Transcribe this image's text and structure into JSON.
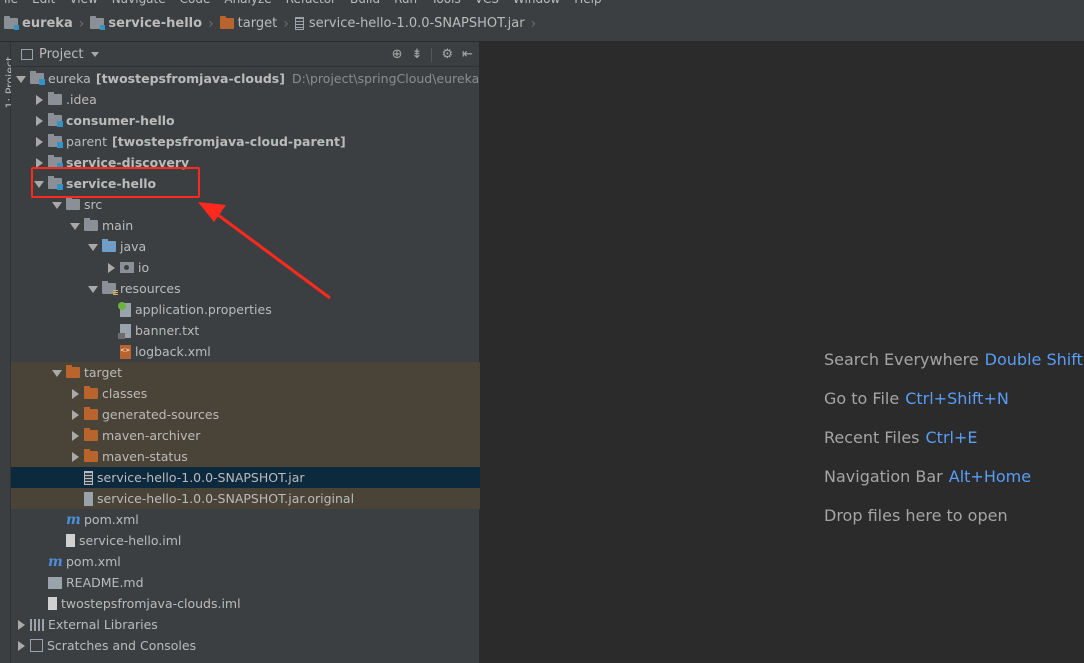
{
  "menu": [
    "ile",
    "Edit",
    "View",
    "Navigate",
    "Code",
    "Analyze",
    "Refactor",
    "Build",
    "Run",
    "Tools",
    "VCS",
    "Window",
    "Help"
  ],
  "breadcrumb": {
    "items": [
      {
        "label": "eureka",
        "bold": true
      },
      {
        "label": "service-hello",
        "bold": true
      },
      {
        "label": "target",
        "bold": false
      },
      {
        "label": "service-hello-1.0.0-SNAPSHOT.jar",
        "bold": false
      }
    ]
  },
  "side_stripe": {
    "tab_label": "1: Project"
  },
  "project_panel": {
    "title": "Project",
    "tree": [
      {
        "label": "eureka",
        "bracket": "[twostepsfromjava-clouds]",
        "path": "D:\\project\\springCloud\\eureka",
        "depth": 0,
        "arrow": "down",
        "icon": "module-folder",
        "bold": false
      },
      {
        "label": ".idea",
        "depth": 1,
        "arrow": "right",
        "icon": "folder",
        "bold": false
      },
      {
        "label": "consumer-hello",
        "depth": 1,
        "arrow": "right",
        "icon": "module-folder",
        "bold": true
      },
      {
        "label": "parent",
        "bracket": "[twostepsfromjava-cloud-parent]",
        "depth": 1,
        "arrow": "right",
        "icon": "module-folder",
        "bold": false
      },
      {
        "label": "service-discovery",
        "depth": 1,
        "arrow": "right",
        "icon": "module-folder",
        "bold": true
      },
      {
        "label": "service-hello",
        "depth": 1,
        "arrow": "down",
        "icon": "module-folder",
        "bold": true
      },
      {
        "label": "src",
        "depth": 2,
        "arrow": "down",
        "icon": "folder",
        "bold": false
      },
      {
        "label": "main",
        "depth": 3,
        "arrow": "down",
        "icon": "folder",
        "bold": false
      },
      {
        "label": "java",
        "depth": 4,
        "arrow": "down",
        "icon": "source-folder",
        "bold": false
      },
      {
        "label": "io",
        "depth": 5,
        "arrow": "right",
        "icon": "package",
        "bold": false
      },
      {
        "label": "resources",
        "depth": 4,
        "arrow": "down",
        "icon": "resource-folder",
        "bold": false
      },
      {
        "label": "application.properties",
        "depth": 5,
        "arrow": "none",
        "icon": "spring-file",
        "bold": false
      },
      {
        "label": "banner.txt",
        "depth": 5,
        "arrow": "none",
        "icon": "text-file",
        "bold": false
      },
      {
        "label": "logback.xml",
        "depth": 5,
        "arrow": "none",
        "icon": "xml-file",
        "bold": false
      },
      {
        "label": "target",
        "depth": 2,
        "arrow": "down",
        "icon": "excluded-folder",
        "bold": false,
        "state": "excluded"
      },
      {
        "label": "classes",
        "depth": 3,
        "arrow": "right",
        "icon": "excluded-folder",
        "bold": false,
        "state": "excluded"
      },
      {
        "label": "generated-sources",
        "depth": 3,
        "arrow": "right",
        "icon": "excluded-folder",
        "bold": false,
        "state": "excluded"
      },
      {
        "label": "maven-archiver",
        "depth": 3,
        "arrow": "right",
        "icon": "excluded-folder",
        "bold": false,
        "state": "excluded"
      },
      {
        "label": "maven-status",
        "depth": 3,
        "arrow": "right",
        "icon": "excluded-folder",
        "bold": false,
        "state": "excluded"
      },
      {
        "label": "service-hello-1.0.0-SNAPSHOT.jar",
        "depth": 3,
        "arrow": "none",
        "icon": "jar-file",
        "bold": false,
        "state": "selected"
      },
      {
        "label": "service-hello-1.0.0-SNAPSHOT.jar.original",
        "depth": 3,
        "arrow": "none",
        "icon": "original-file",
        "bold": false,
        "state": "excluded"
      },
      {
        "label": "pom.xml",
        "depth": 2,
        "arrow": "none",
        "icon": "maven-file",
        "bold": false
      },
      {
        "label": "service-hello.iml",
        "depth": 2,
        "arrow": "none",
        "icon": "iml-file",
        "bold": false
      },
      {
        "label": "pom.xml",
        "depth": 1,
        "arrow": "none",
        "icon": "maven-file",
        "bold": false
      },
      {
        "label": "README.md",
        "depth": 1,
        "arrow": "none",
        "icon": "md-file",
        "bold": false
      },
      {
        "label": "twostepsfromjava-clouds.iml",
        "depth": 1,
        "arrow": "none",
        "icon": "iml-file",
        "bold": false
      },
      {
        "label": "External Libraries",
        "depth": 0,
        "arrow": "right",
        "icon": "libraries",
        "bold": false
      },
      {
        "label": "Scratches and Consoles",
        "depth": 0,
        "arrow": "right",
        "icon": "scratches",
        "bold": false
      }
    ]
  },
  "editor_hints": [
    {
      "text": "Search Everywhere",
      "key": "Double Shift"
    },
    {
      "text": "Go to File",
      "key": "Ctrl+Shift+N"
    },
    {
      "text": "Recent Files",
      "key": "Ctrl+E"
    },
    {
      "text": "Navigation Bar",
      "key": "Alt+Home"
    },
    {
      "text": "Drop files here to open",
      "key": ""
    }
  ],
  "colors": {
    "annotation": "#ff2a1d",
    "key_hint": "#589df6",
    "selection": "#0d293e",
    "excluded": "#4a4337"
  }
}
